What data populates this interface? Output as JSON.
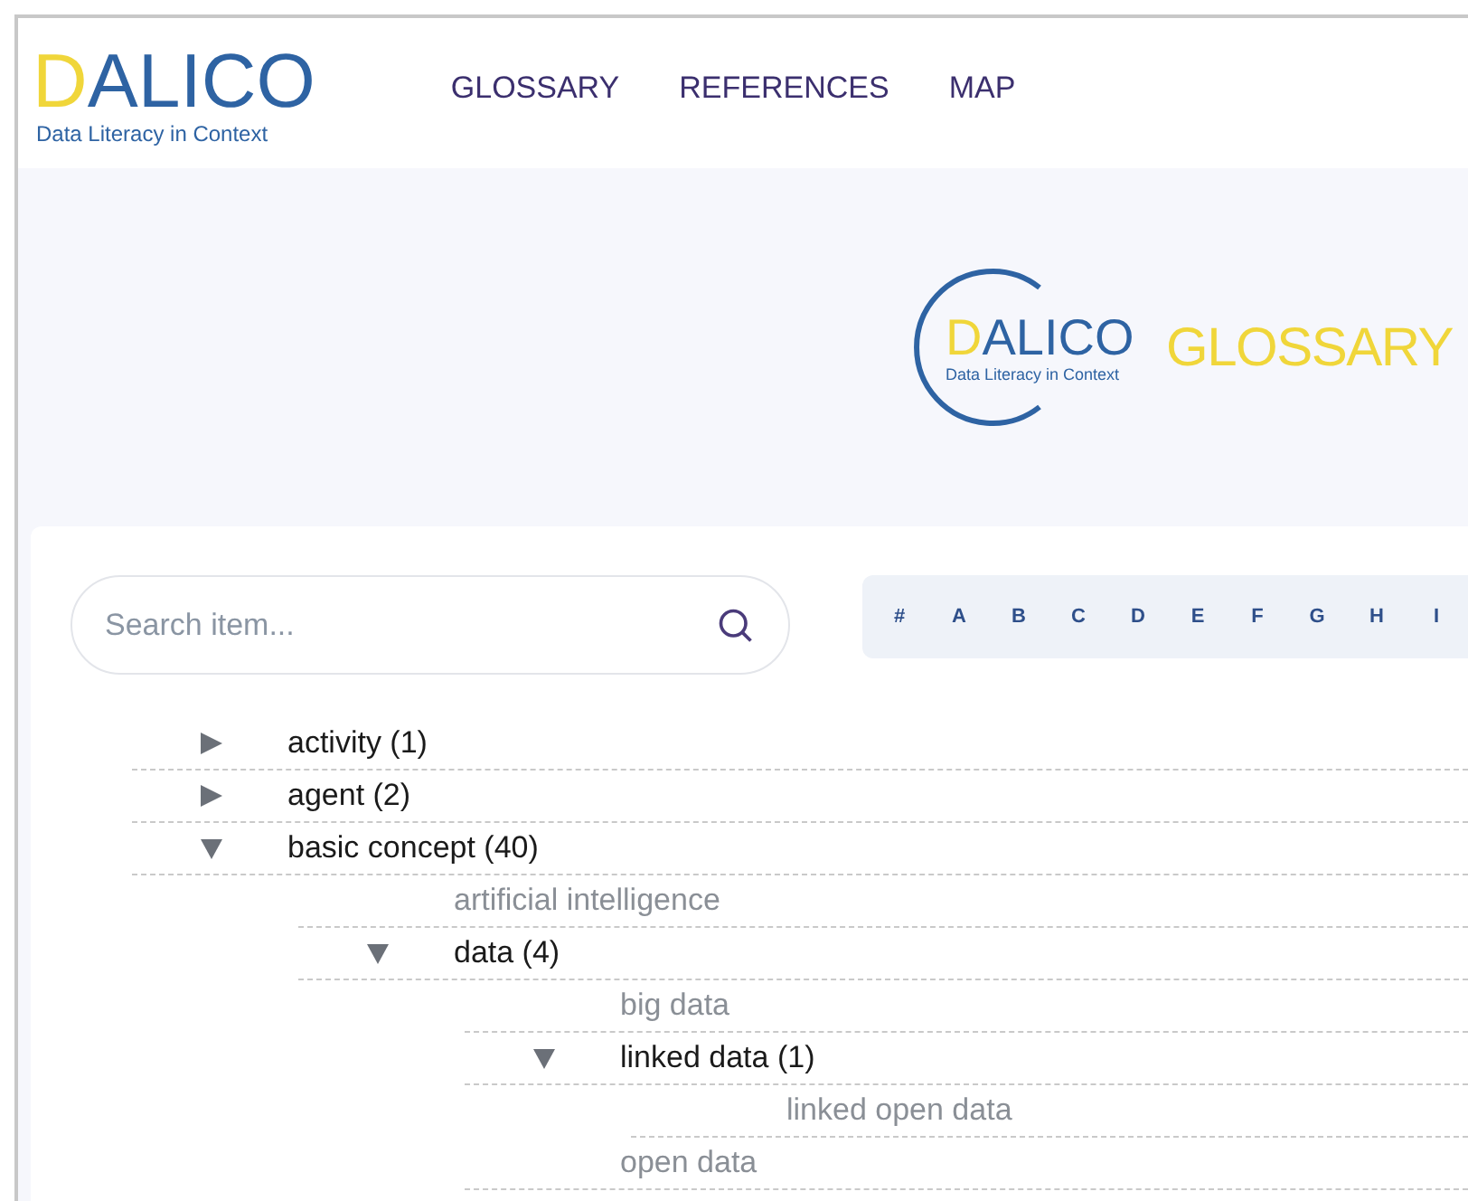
{
  "header": {
    "logo": {
      "first_letter": "D",
      "rest": "ALICO",
      "tagline": "Data Literacy in Context"
    },
    "nav": [
      {
        "label": "GLOSSARY"
      },
      {
        "label": "REFERENCES"
      },
      {
        "label": "MAP"
      }
    ]
  },
  "hero": {
    "logo": {
      "first_letter": "D",
      "rest": "ALICO",
      "tagline": "Data Literacy in Context"
    },
    "title": "GLOSSARY"
  },
  "search": {
    "placeholder": "Search item..."
  },
  "alphabet": [
    "#",
    "A",
    "B",
    "C",
    "D",
    "E",
    "F",
    "G",
    "H",
    "I"
  ],
  "tree": [
    {
      "kind": "branch",
      "label": "activity (1)",
      "expanded": false
    },
    {
      "kind": "branch",
      "label": "agent (2)",
      "expanded": false
    },
    {
      "kind": "branch",
      "label": "basic concept (40)",
      "expanded": true,
      "children": [
        {
          "kind": "leaf",
          "label": "artificial intelligence"
        },
        {
          "kind": "branch",
          "label": "data (4)",
          "expanded": true,
          "children": [
            {
              "kind": "leaf",
              "label": "big data"
            },
            {
              "kind": "branch",
              "label": "linked data (1)",
              "expanded": true,
              "children": [
                {
                  "kind": "leaf",
                  "label": "linked open data"
                }
              ]
            },
            {
              "kind": "leaf",
              "label": "open data"
            }
          ]
        }
      ]
    }
  ]
}
